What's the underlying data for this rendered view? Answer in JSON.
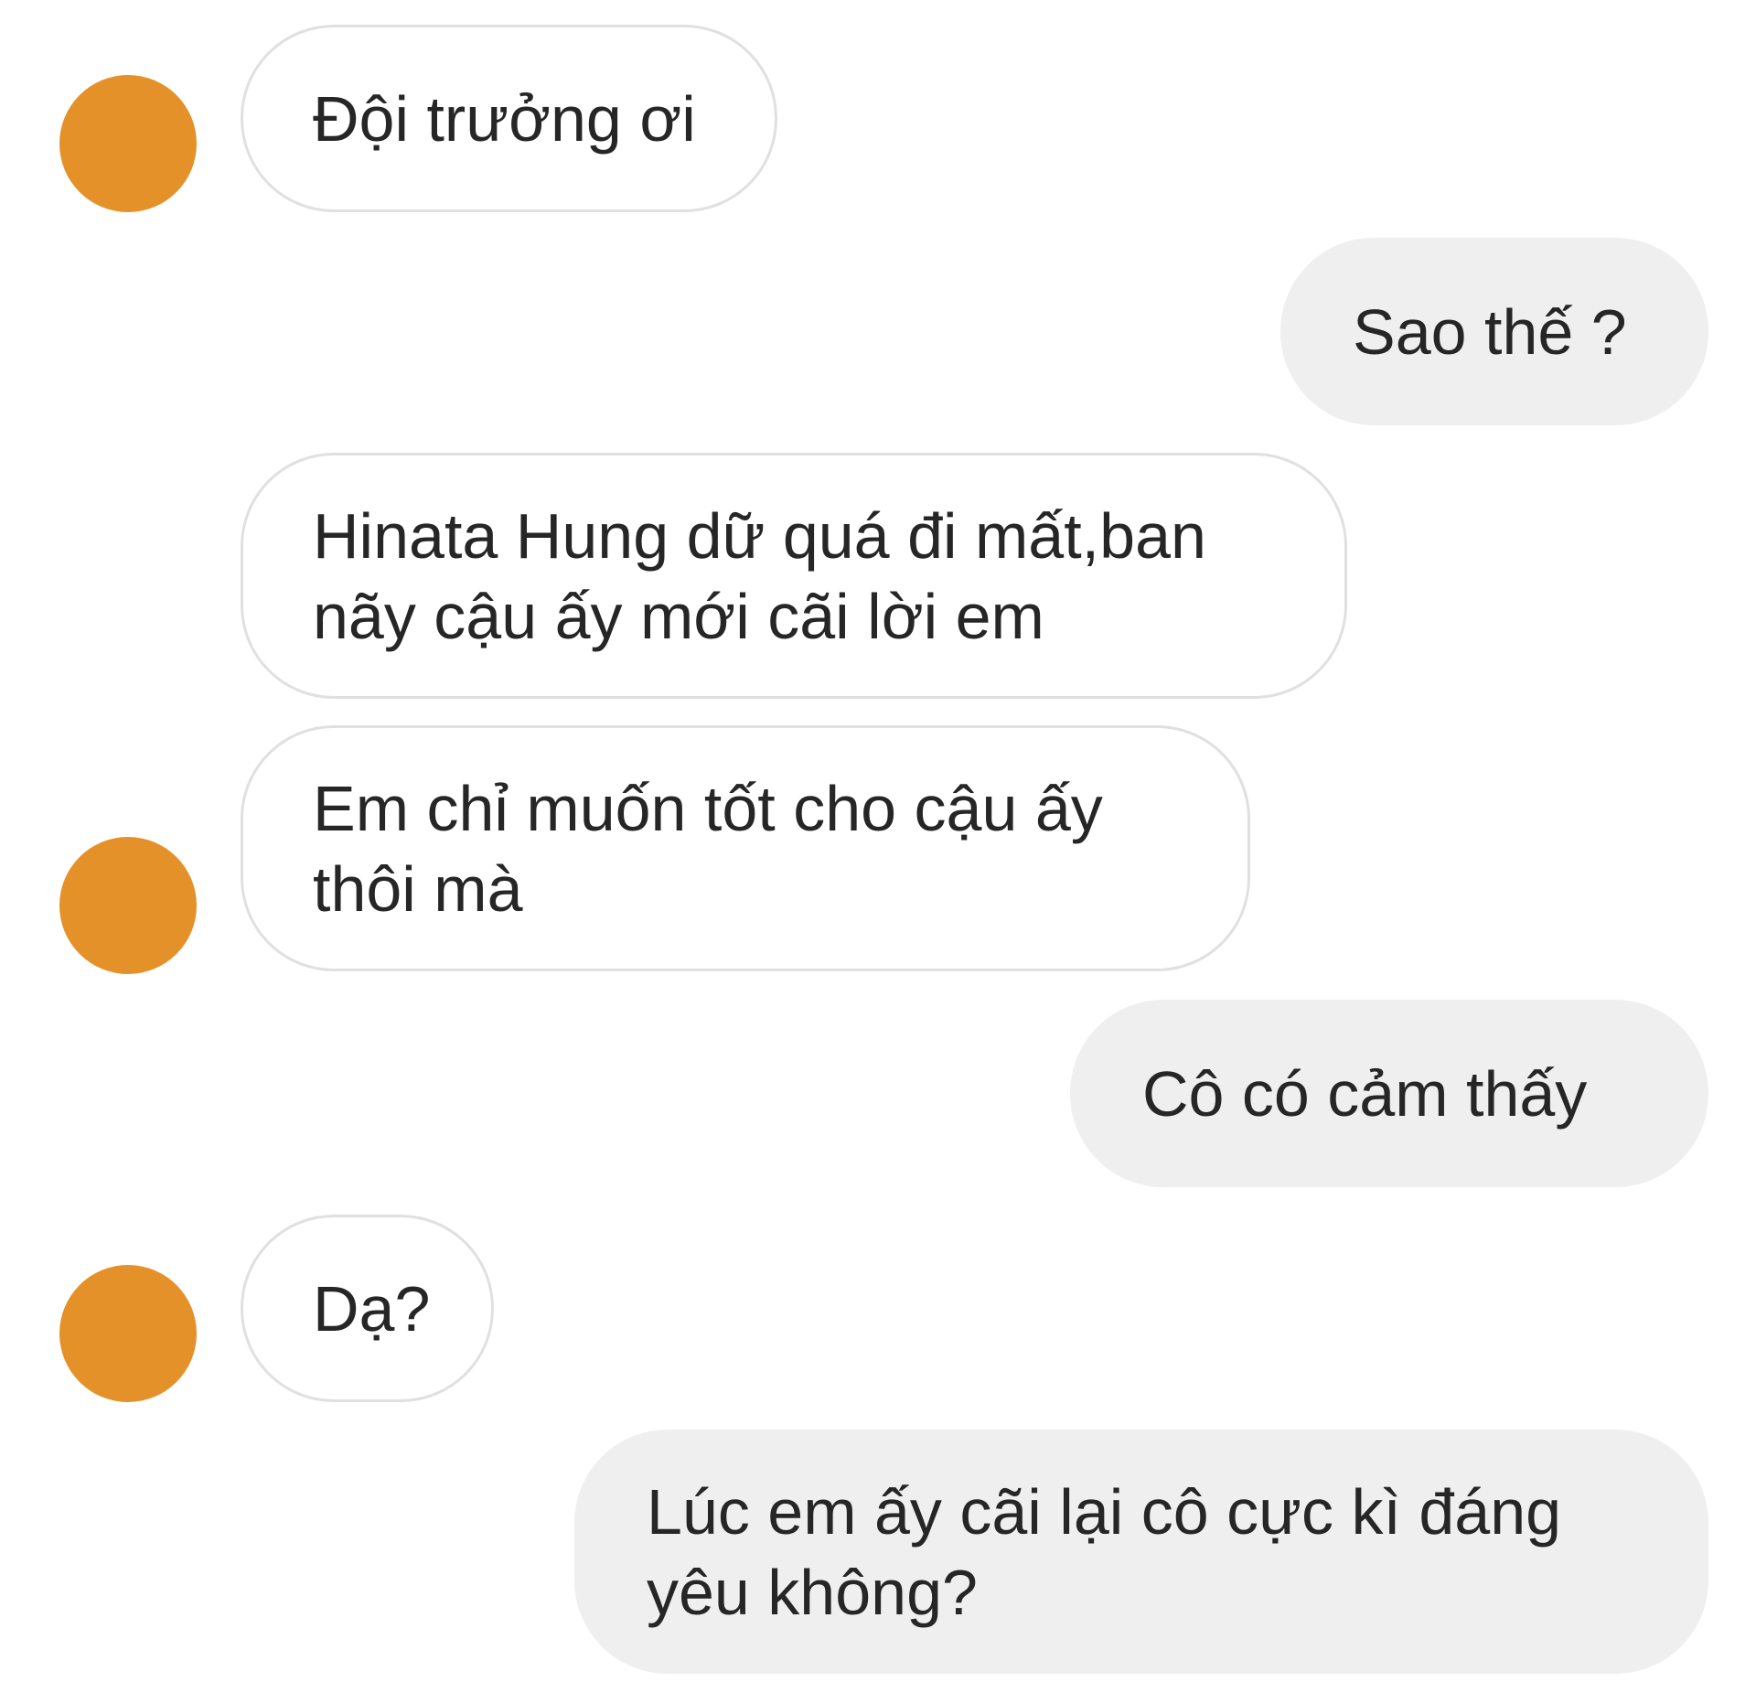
{
  "conversation": {
    "theme": {
      "avatar_color": "#e5912a",
      "incoming_bg": "#ffffff",
      "incoming_border": "#e0e0e0",
      "outgoing_bg": "#efefef",
      "text_color": "#262626"
    },
    "messages": [
      {
        "direction": "incoming",
        "text": "Đội trưởng ơi"
      },
      {
        "direction": "outgoing",
        "text": "Sao thế ?"
      },
      {
        "direction": "incoming",
        "text": "Hinata Hung dữ quá đi mất,ban nãy cậu ấy mới cãi lời em"
      },
      {
        "direction": "incoming",
        "text": "Em chỉ muốn tốt cho cậu ấy thôi mà"
      },
      {
        "direction": "outgoing",
        "text": "Cô có cảm thấy"
      },
      {
        "direction": "incoming",
        "text": "Dạ?"
      },
      {
        "direction": "outgoing",
        "text": "Lúc em ấy cãi lại cô cực kì đáng yêu không?"
      }
    ]
  }
}
